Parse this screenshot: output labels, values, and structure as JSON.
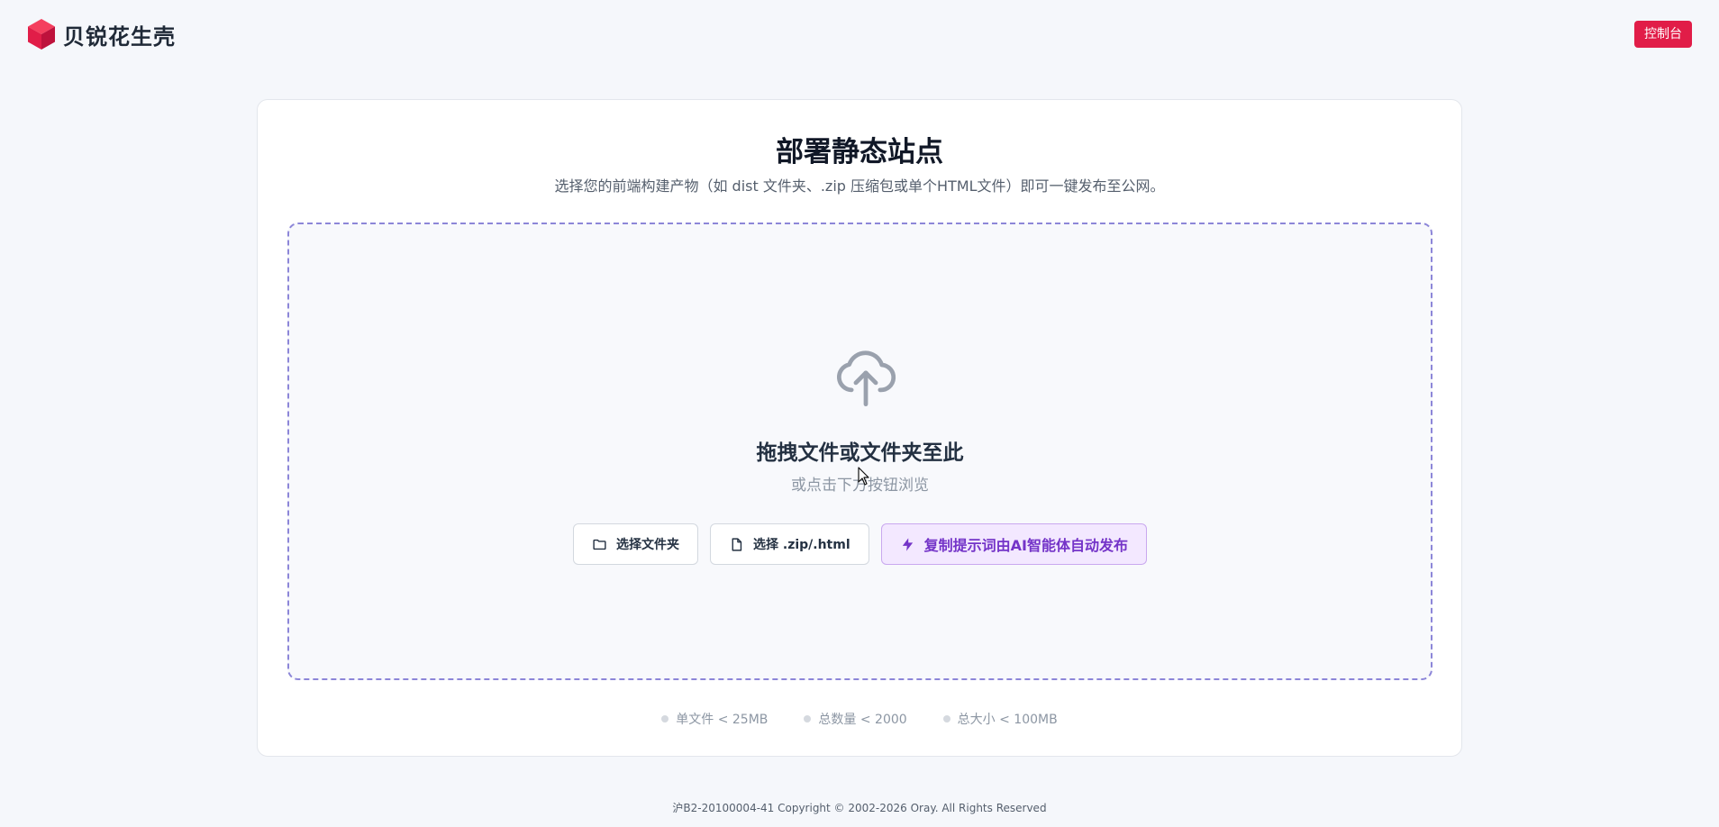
{
  "header": {
    "logo_text": "贝锐花生壳",
    "console_button": "控制台",
    "brand_color": "#e11d48"
  },
  "main": {
    "title": "部署静态站点",
    "subtitle": "选择您的前端构建产物（如 dist 文件夹、.zip 压缩包或单个HTML文件）即可一键发布至公网。"
  },
  "dropzone": {
    "icon": "cloud-upload-icon",
    "title": "拖拽文件或文件夹至此",
    "hint": "或点击下方按钮浏览",
    "buttons": {
      "folder": "选择文件夹",
      "file": "选择 .zip/.html",
      "ai": "复制提示词由AI智能体自动发布"
    },
    "ai_accent_color": "#7434c8"
  },
  "limits": [
    "单文件 < 25MB",
    "总数量 < 2000",
    "总大小 < 100MB"
  ],
  "footer": {
    "text": "沪B2-20100004-41  Copyright © 2002-2026 Oray. All Rights Reserved"
  }
}
